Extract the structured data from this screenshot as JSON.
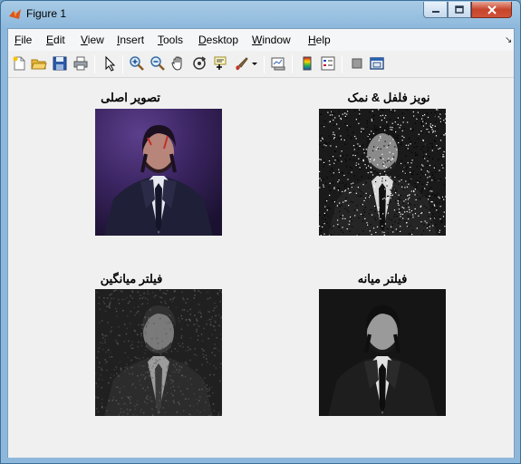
{
  "window": {
    "title": "Figure 1"
  },
  "menu": [
    {
      "label": "File",
      "mnemonic": "F",
      "rest": "ile"
    },
    {
      "label": "Edit",
      "mnemonic": "E",
      "rest": "dit"
    },
    {
      "label": "View",
      "mnemonic": "V",
      "rest": "iew"
    },
    {
      "label": "Insert",
      "mnemonic": "I",
      "rest": "nsert"
    },
    {
      "label": "Tools",
      "mnemonic": "T",
      "rest": "ools"
    },
    {
      "label": "Desktop",
      "mnemonic": "D",
      "rest": "esktop"
    },
    {
      "label": "Window",
      "mnemonic": "W",
      "rest": "indow"
    },
    {
      "label": "Help",
      "mnemonic": "H",
      "rest": "elp"
    }
  ],
  "toolbar": {
    "icons": [
      "new-figure-icon",
      "open-file-icon",
      "save-icon",
      "print-icon",
      "edit-plot-arrow-icon",
      "zoom-in-icon",
      "zoom-out-icon",
      "pan-hand-icon",
      "rotate-3d-icon",
      "data-cursor-icon",
      "brush-icon",
      "brush-dropdown-icon",
      "link-plot-icon",
      "colorbar-icon",
      "legend-icon",
      "hide-plot-tools-icon",
      "show-plot-tools-icon"
    ]
  },
  "subplots": {
    "original": {
      "title": "تصویر اصلی"
    },
    "noise": {
      "title": "نویز فلفل & نمک"
    },
    "mean": {
      "title": "فیلتر میانگین"
    },
    "median": {
      "title": "فیلتر میانه"
    }
  },
  "colors": {
    "titlebar": "#a8cbe6",
    "close_button": "#c7452b",
    "figure_bg": "#f0f0f0"
  }
}
